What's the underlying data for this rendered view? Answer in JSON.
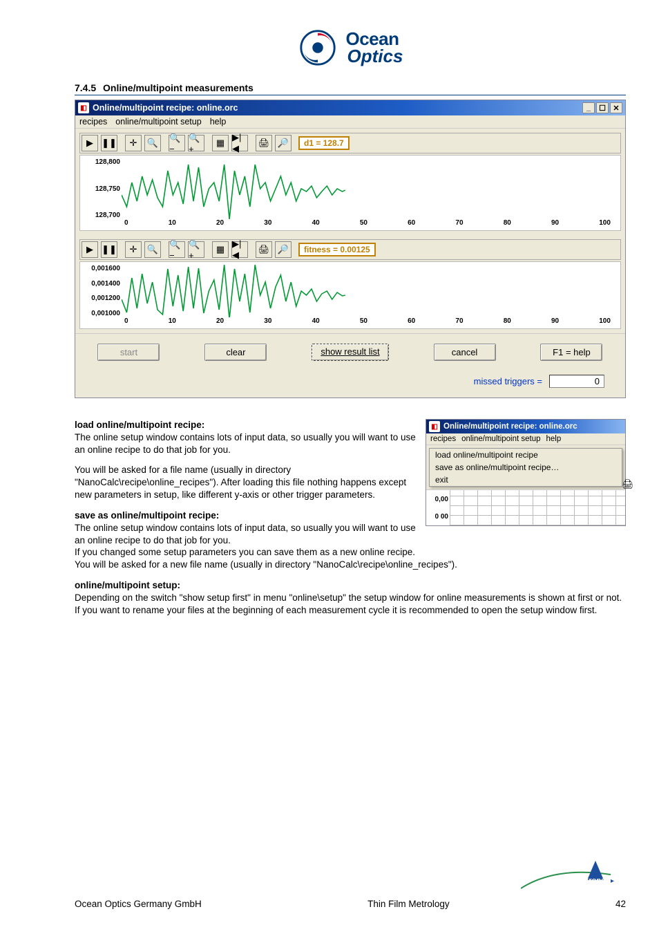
{
  "logo": {
    "line1": "Ocean",
    "line2": "Optics"
  },
  "section": {
    "num": "7.4.5",
    "title": "Online/multipoint measurements"
  },
  "window": {
    "title": "Online/multipoint recipe: online.orc",
    "menu": [
      "recipes",
      "online/multipoint setup",
      "help"
    ],
    "chart1": {
      "readout": "d1 = 128.7",
      "yticks": [
        "128,800",
        "128,750",
        "128,700"
      ],
      "xticks": [
        "0",
        "10",
        "20",
        "30",
        "40",
        "50",
        "60",
        "70",
        "80",
        "90",
        "100"
      ]
    },
    "chart2": {
      "readout": "fitness = 0.00125",
      "yticks": [
        "0,001600",
        "0,001400",
        "0,001200",
        "0,001000"
      ],
      "xticks": [
        "0",
        "10",
        "20",
        "30",
        "40",
        "50",
        "60",
        "70",
        "80",
        "90",
        "100"
      ]
    },
    "buttons": {
      "start": "start",
      "clear": "clear",
      "show": "show result list",
      "cancel": "cancel",
      "help": "F1 = help"
    },
    "status_label": "missed triggers =",
    "status_value": "0"
  },
  "body": {
    "h1": "load online/multipoint recipe:",
    "p1a": "The online setup window contains lots of input data, so usually you will want to use an online recipe to do that job for you.",
    "p1b": "You will be asked for a file name (usually in directory \"NanoCalc\\recipe\\online_recipes\"). After loading this file nothing happens except new parameters in setup, like different y-axis or other trigger parameters.",
    "h2": "save as online/multipoint recipe:",
    "p2a": "The online setup window contains lots of input data, so usually you will want to use an online recipe to do that job for you.",
    "p2b": "If you changed some setup parameters you can save them as a new online recipe.",
    "p2c": "You will be asked for a new file name (usually in directory \"NanoCalc\\recipe\\online_recipes\").",
    "h3": "online/multipoint setup:",
    "p3": "Depending on the switch \"show setup first\" in menu \"online\\setup\" the setup window for online measurements is shown at first or not. If you want to rename your files at the beginning of each measurement cycle it is recommended to open the setup window first."
  },
  "inset": {
    "title": "Online/multipoint recipe: online.orc",
    "menu": [
      "recipes",
      "online/multipoint setup",
      "help"
    ],
    "dropdown": [
      "load online/multipoint recipe",
      "save as online/multipoint recipe…",
      "exit"
    ],
    "ytick": "0,00",
    "ytick2": "0 00"
  },
  "footer": {
    "left": "Ocean Optics Germany GmbH",
    "center": "Thin Film Metrology",
    "page": "42"
  },
  "chart_data": [
    {
      "type": "line",
      "title": "d1",
      "xlabel": "",
      "ylabel": "",
      "xlim": [
        0,
        100
      ],
      "ylim": [
        128700,
        128800
      ],
      "categories": [
        0,
        1,
        2,
        3,
        4,
        5,
        6,
        7,
        8,
        9,
        10,
        11,
        12,
        13,
        14,
        15,
        16,
        17,
        18,
        19,
        20,
        21,
        22,
        23,
        24,
        25,
        26,
        27,
        28,
        29,
        30,
        31,
        32,
        33,
        34,
        35,
        36,
        37,
        38,
        39,
        40,
        41,
        42,
        43,
        44,
        45
      ],
      "values": [
        128740,
        128720,
        128760,
        128730,
        128770,
        128740,
        128765,
        128735,
        128720,
        128780,
        128740,
        128760,
        128725,
        128790,
        128730,
        128785,
        128720,
        128750,
        128760,
        128730,
        128790,
        128700,
        128780,
        128740,
        128770,
        128720,
        128790,
        128750,
        128760,
        128730,
        128750,
        128770,
        128740,
        128760,
        128730,
        128750,
        128745,
        128755,
        128735,
        128745,
        128755,
        128740,
        128750,
        128745,
        128748,
        128746
      ],
      "readout": "d1 = 128.7"
    },
    {
      "type": "line",
      "title": "fitness",
      "xlabel": "",
      "ylabel": "",
      "xlim": [
        0,
        100
      ],
      "ylim": [
        0.001,
        0.0016
      ],
      "categories": [
        0,
        1,
        2,
        3,
        4,
        5,
        6,
        7,
        8,
        9,
        10,
        11,
        12,
        13,
        14,
        15,
        16,
        17,
        18,
        19,
        20,
        21,
        22,
        23,
        24,
        25,
        26,
        27,
        28,
        29,
        30,
        31,
        32,
        33,
        34,
        35,
        36,
        37,
        38,
        39,
        40,
        41,
        42,
        43,
        44,
        45
      ],
      "values": [
        0.0012,
        0.00105,
        0.00145,
        0.0011,
        0.0015,
        0.00115,
        0.0014,
        0.00108,
        0.00102,
        0.00155,
        0.00112,
        0.00148,
        0.00106,
        0.00158,
        0.0011,
        0.00156,
        0.00104,
        0.0013,
        0.00142,
        0.00108,
        0.0016,
        0.00098,
        0.00155,
        0.00118,
        0.0015,
        0.00105,
        0.0016,
        0.00125,
        0.0014,
        0.0011,
        0.00135,
        0.00148,
        0.00118,
        0.0014,
        0.00112,
        0.0013,
        0.00125,
        0.00132,
        0.00118,
        0.00126,
        0.0013,
        0.0012,
        0.00128,
        0.00124,
        0.00126,
        0.00125
      ],
      "readout": "fitness = 0.00125"
    }
  ]
}
